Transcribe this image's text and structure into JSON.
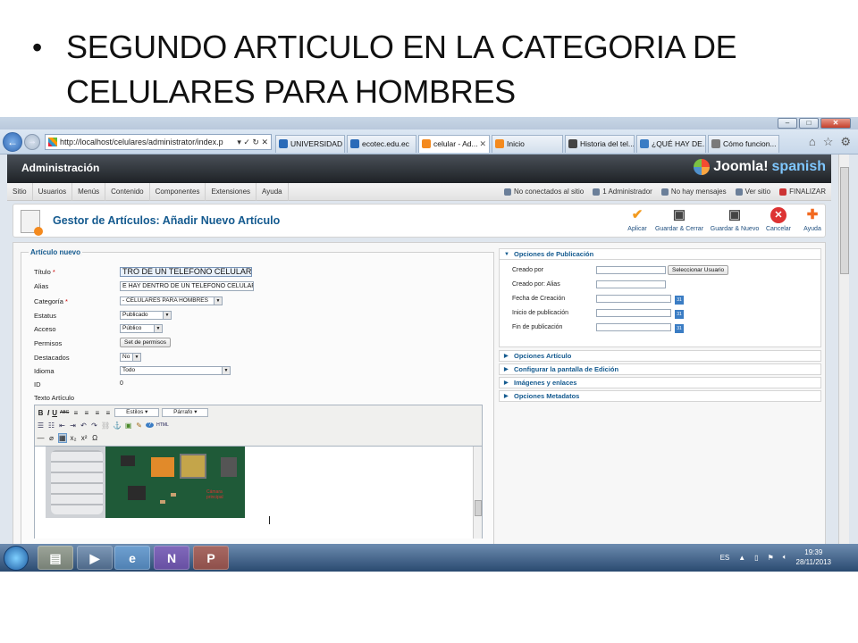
{
  "slide": {
    "bullet": "•",
    "title": "SEGUNDO ARTICULO EN LA CATEGORIA DE CELULARES PARA HOMBRES"
  },
  "browser": {
    "address": "http://localhost/celulares/administrator/index.p",
    "address_tools": "▾ ✓ ↻ ✕",
    "tabs": [
      {
        "label": "UNIVERSIDAD ...",
        "color": "#2a6bb8"
      },
      {
        "label": "ecotec.edu.ec",
        "color": "#2a6bb8"
      },
      {
        "label": "celular - Ad...",
        "color": "#f48a1e"
      },
      {
        "label": "Inicio",
        "color": "#f48a1e"
      },
      {
        "label": "Historia del tel...",
        "color": "#444444"
      },
      {
        "label": "¿QUÉ HAY DE...",
        "color": "#3b7dc4"
      },
      {
        "label": "Cómo funcion...",
        "color": "#7a7a7a"
      }
    ],
    "active_tab_close": "✕"
  },
  "joomla": {
    "admin_title": "Administración",
    "logo_text": "Joomla!",
    "logo_sub": "spanish",
    "menu": [
      "Sitio",
      "Usuarios",
      "Menús",
      "Contenido",
      "Componentes",
      "Extensiones",
      "Ayuda"
    ],
    "status": {
      "not_connected": "No conectados al sitio",
      "admins": "1 Administrador",
      "messages": "No hay mensajes",
      "view_site": "Ver sitio",
      "logout": "FINALIZAR"
    },
    "page_title": "Gestor de Artículos: Añadir Nuevo Artículo",
    "toolbar": {
      "apply": "Aplicar",
      "save_close": "Guardar & Cerrar",
      "save_new": "Guardar & Nuevo",
      "cancel": "Cancelar",
      "help": "Ayuda"
    },
    "form": {
      "legend": "Artículo nuevo",
      "title_label": "Título",
      "title_value": "TRO DE UN TELEFONO CELULAR",
      "alias_label": "Alias",
      "alias_value": "E HAY DENTRO DE UN TELEFONO CELULAR?",
      "category_label": "Categoría",
      "category_value": "- CELULARES PARA HOMBRES",
      "status_label": "Estatus",
      "status_value": "Publicado",
      "access_label": "Acceso",
      "access_value": "Público",
      "permissions_label": "Permisos",
      "permissions_button": "Set de permisos",
      "featured_label": "Destacados",
      "featured_value": "No",
      "language_label": "Idioma",
      "language_value": "Todo",
      "id_label": "ID",
      "id_value": "0",
      "text_label": "Texto Artículo",
      "required_mark": "*"
    },
    "editor": {
      "styles": "Estilos",
      "paragraph": "Párrafo",
      "row1": [
        "B",
        "I",
        "U",
        "ABC",
        "≡",
        "≡",
        "≡",
        "≡"
      ],
      "row2": [
        "☰",
        "☷",
        "⇤",
        "⇥",
        "↶",
        "↷",
        "⛓",
        "⚓",
        "▣",
        "✎",
        "?",
        "HTML"
      ],
      "row3": [
        "—",
        "⌀",
        "▦",
        "x₂",
        "x²",
        "Ω"
      ],
      "image_caption": "Cámara principal"
    },
    "right": {
      "pub_options": "Opciones de Publicación",
      "created_by": "Creado por",
      "select_user": "Seleccionar Usuario",
      "created_alias": "Creado por: Alias",
      "created_date": "Fecha de Creación",
      "publish_start": "Inicio de publicación",
      "publish_end": "Fin de publicación",
      "calendar": "31",
      "sections": [
        "Opciones Artículo",
        "Configurar la pantalla de Edición",
        "Imágenes y enlaces",
        "Opciones Metadatos"
      ]
    }
  },
  "taskbar": {
    "lang": "ES",
    "time": "19:39",
    "date": "28/11/2013"
  }
}
